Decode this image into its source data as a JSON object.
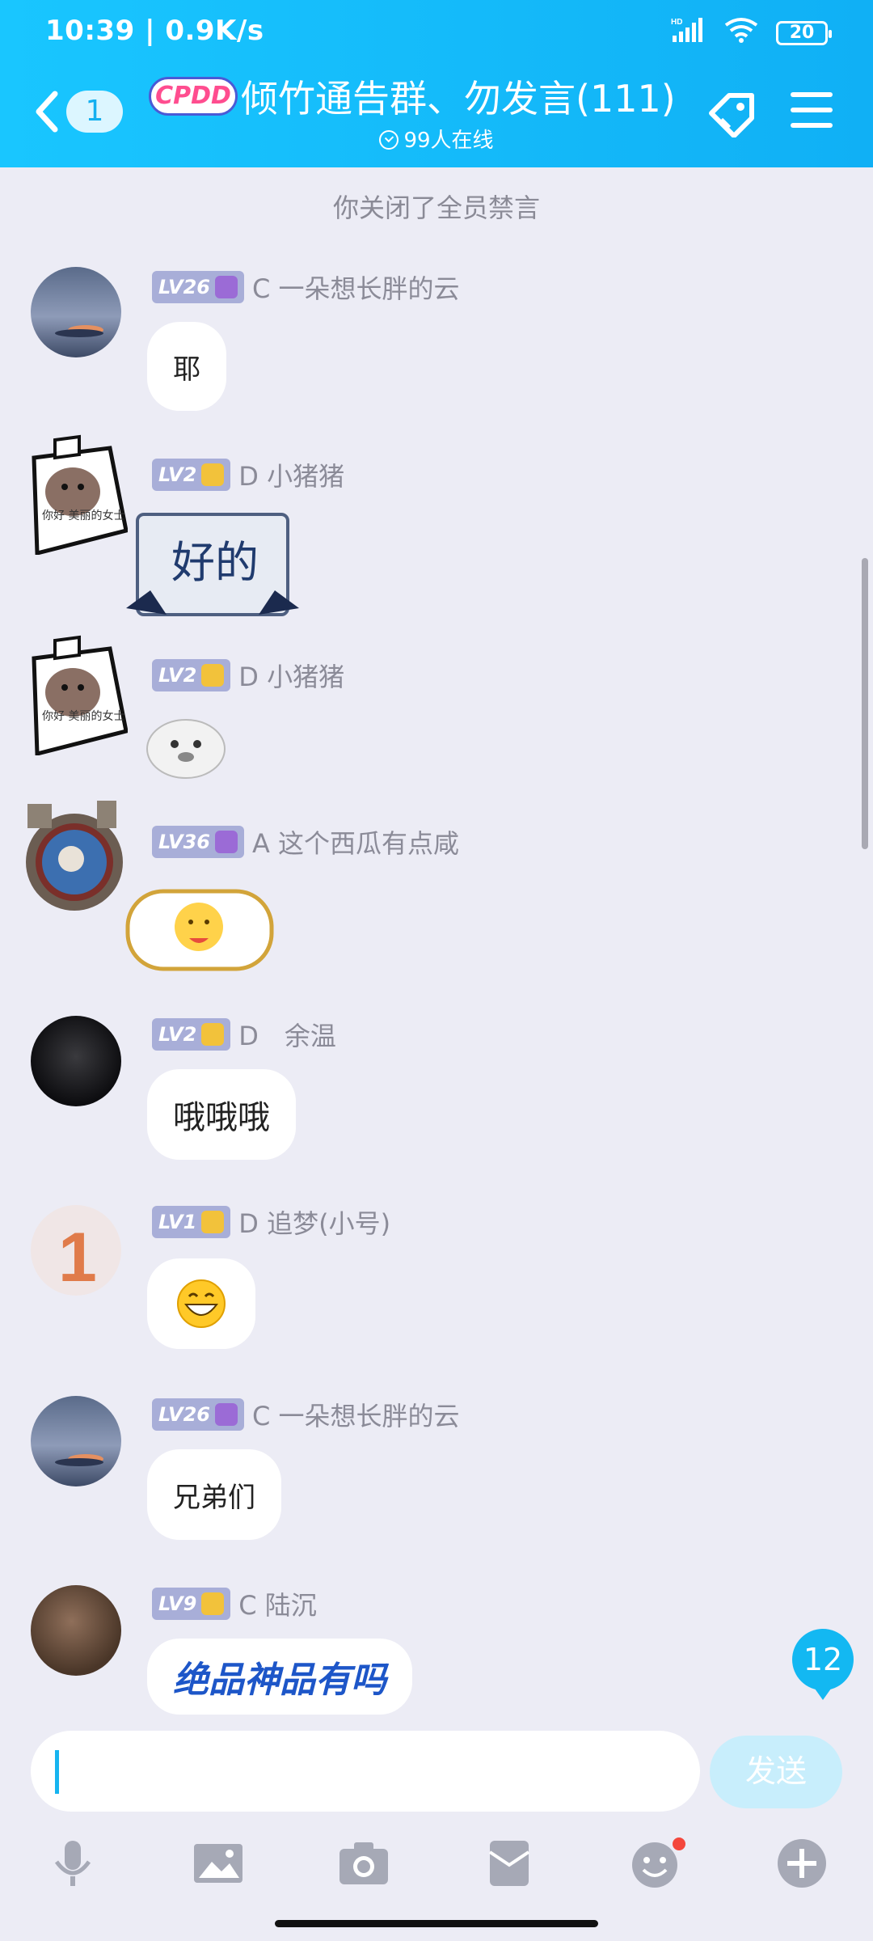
{
  "status_bar": {
    "time": "10:39 | 0.9K/s",
    "network": "HD",
    "battery": "20"
  },
  "header": {
    "back_count": "1",
    "logo_text": "CPDD",
    "title": "倾竹通告群、勿发言(111)",
    "online": "99人在线"
  },
  "notice": "你关闭了全员禁言",
  "messages": [
    {
      "level": "LV26",
      "sender": "C 一朵想长胖的云",
      "text": "耶",
      "type": "text"
    },
    {
      "level": "LV2",
      "sender": "D 小猪猪",
      "text": "好的",
      "type": "sticker"
    },
    {
      "level": "LV2",
      "sender": "D 小猪猪",
      "text": "",
      "type": "sticker"
    },
    {
      "level": "LV36",
      "sender": "A 这个西瓜有点咸",
      "text": "",
      "type": "emoji"
    },
    {
      "level": "LV2",
      "sender": "D　余温",
      "text": "哦哦哦",
      "type": "text"
    },
    {
      "level": "LV1",
      "sender": "D 追梦(小号)",
      "text": "",
      "type": "emoji"
    },
    {
      "level": "LV26",
      "sender": "C 一朵想长胖的云",
      "text": "兄弟们",
      "type": "text"
    },
    {
      "level": "LV9",
      "sender": "C 陆沉",
      "text": "绝品神品有吗",
      "type": "text"
    }
  ],
  "avatar_texts": {
    "pig": "你好 美丽的女士"
  },
  "unread_count": "12",
  "input": {
    "placeholder": "",
    "send_label": "发送"
  },
  "colors": {
    "header": "#12b8f6",
    "background": "#ececf5",
    "accent": "#13b8f2"
  }
}
